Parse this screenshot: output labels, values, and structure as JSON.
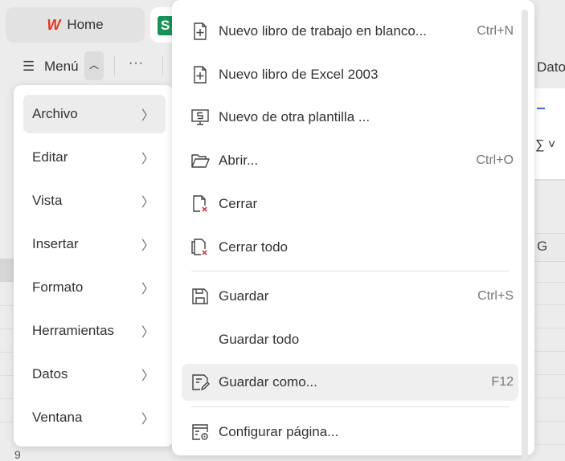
{
  "tabs": {
    "home": "Home",
    "home_logo": "W",
    "sheet_logo": "S"
  },
  "toolbar": {
    "menu": "Menú",
    "more": "···"
  },
  "background": {
    "ribbon_tab": "Dato",
    "column_header": "G",
    "row_number": "9"
  },
  "left_menu": [
    {
      "label": "Archivo",
      "active": true
    },
    {
      "label": "Editar"
    },
    {
      "label": "Vista"
    },
    {
      "label": "Insertar"
    },
    {
      "label": "Formato"
    },
    {
      "label": "Herramientas"
    },
    {
      "label": "Datos"
    },
    {
      "label": "Ventana"
    }
  ],
  "file_menu": [
    {
      "label": "Nuevo libro de trabajo en blanco...",
      "shortcut": "Ctrl+N",
      "icon": "new-file-icon"
    },
    {
      "label": "Nuevo libro de Excel 2003",
      "shortcut": "",
      "icon": "new-file-icon"
    },
    {
      "label": "Nuevo de otra plantilla ...",
      "shortcut": "",
      "icon": "template-icon"
    },
    {
      "label": "Abrir...",
      "shortcut": "Ctrl+O",
      "icon": "folder-open-icon"
    },
    {
      "label": "Cerrar",
      "shortcut": "",
      "icon": "close-file-icon"
    },
    {
      "label": "Cerrar todo",
      "shortcut": "",
      "icon": "close-all-icon"
    },
    {
      "label": "Guardar",
      "shortcut": "Ctrl+S",
      "icon": "save-icon"
    },
    {
      "label": "Guardar todo",
      "shortcut": "",
      "icon": ""
    },
    {
      "label": "Guardar como...",
      "shortcut": "F12",
      "icon": "save-as-icon"
    },
    {
      "label": "Configurar página...",
      "shortcut": "",
      "icon": "page-setup-icon"
    }
  ],
  "colors": {
    "accent_red": "#e0314b",
    "sheet_green": "#16945a",
    "wps_red": "#e8341c"
  }
}
